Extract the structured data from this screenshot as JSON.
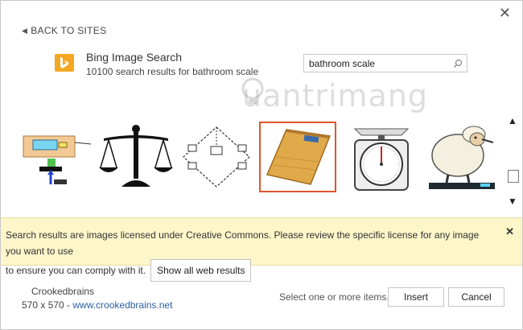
{
  "dialog": {
    "close_glyph": "✕"
  },
  "nav": {
    "back_label": "BACK TO SITES"
  },
  "provider": {
    "name": "Bing Image Search",
    "summary": "10100 search results for bathroom scale"
  },
  "search": {
    "value": "bathroom scale",
    "placeholder": ""
  },
  "watermark": {
    "text": "uantrimang"
  },
  "thumbnails": [
    {
      "name": "thumb-circuit-diagram",
      "selected": false
    },
    {
      "name": "thumb-balance-scale",
      "selected": false
    },
    {
      "name": "thumb-bridge-circuit",
      "selected": false
    },
    {
      "name": "thumb-bathroom-scale",
      "selected": true
    },
    {
      "name": "thumb-kitchen-scale",
      "selected": false
    },
    {
      "name": "thumb-sheep-on-scale",
      "selected": false
    }
  ],
  "scroll": {
    "up_glyph": "▲",
    "down_glyph": "▼"
  },
  "banner": {
    "line1": "Search results are images licensed under Creative Commons. Please review the specific license for any image you want to use",
    "line2": "to ensure you can comply with it.",
    "button": "Show all web results",
    "close_glyph": "✕"
  },
  "selection": {
    "name": "Crookedbrains",
    "dimensions": "570 x 570 - ",
    "link": "www.crookedbrains.net"
  },
  "footer": {
    "hint": "Select one or more items.",
    "insert": "Insert",
    "cancel": "Cancel"
  },
  "colors": {
    "accent_selected": "#e0552a",
    "banner_bg": "#fcf6c9",
    "link": "#2b5fa5",
    "bing": "#f5a623"
  }
}
